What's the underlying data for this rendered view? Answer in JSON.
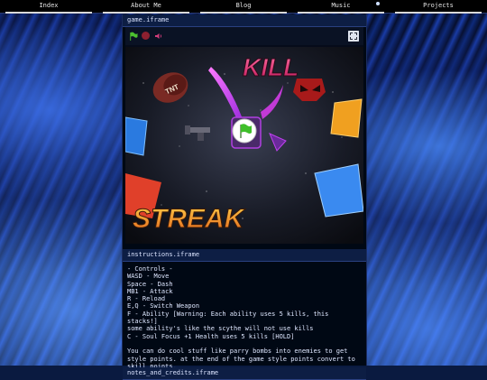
{
  "nav": {
    "items": [
      "Index",
      "About Me",
      "Blog",
      "Music",
      "Projects"
    ]
  },
  "game_panel": {
    "title": "game.iframe",
    "toolbar_icons": [
      "green-flag-icon",
      "stop-icon",
      "speaker-icon",
      "fullscreen-icon"
    ],
    "game_title_top": "KILL",
    "game_title_bottom": "STREAK",
    "tnt_label": "TNT"
  },
  "instructions_panel": {
    "title": "instructions.iframe",
    "body": "- Controls -\nWASD - Move\nSpace - Dash\nMB1 - Attack\nR - Reload\nE,Q - Switch Weapon\nF - Ability [Warning: Each ability uses 5 kills, this stacks!]\nsome ability's like the scythe will not use kills\nC - Soul Focus +1 Health uses 5 kills [HOLD]\n\nYou can do cool stuff like parry bombs into enemies to get style points. at the end of the game style points convert to skill points."
  },
  "notes_panel": {
    "title": "notes_and_credits.iframe"
  },
  "colors": {
    "page_background": "#0a1a40",
    "panel_header": "#0d1e44",
    "title_kill": "#e0306e",
    "title_streak": "#f08a22"
  }
}
